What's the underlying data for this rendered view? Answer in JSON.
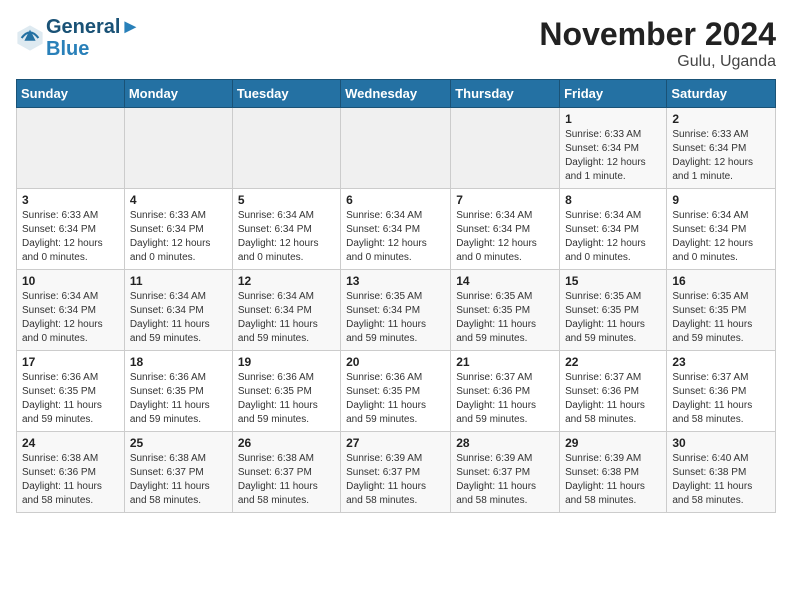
{
  "header": {
    "logo_line1": "General",
    "logo_line2": "Blue",
    "month_title": "November 2024",
    "location": "Gulu, Uganda"
  },
  "weekdays": [
    "Sunday",
    "Monday",
    "Tuesday",
    "Wednesday",
    "Thursday",
    "Friday",
    "Saturday"
  ],
  "weeks": [
    {
      "days": [
        {
          "num": "",
          "info": ""
        },
        {
          "num": "",
          "info": ""
        },
        {
          "num": "",
          "info": ""
        },
        {
          "num": "",
          "info": ""
        },
        {
          "num": "",
          "info": ""
        },
        {
          "num": "1",
          "info": "Sunrise: 6:33 AM\nSunset: 6:34 PM\nDaylight: 12 hours and 1 minute."
        },
        {
          "num": "2",
          "info": "Sunrise: 6:33 AM\nSunset: 6:34 PM\nDaylight: 12 hours and 1 minute."
        }
      ]
    },
    {
      "days": [
        {
          "num": "3",
          "info": "Sunrise: 6:33 AM\nSunset: 6:34 PM\nDaylight: 12 hours and 0 minutes."
        },
        {
          "num": "4",
          "info": "Sunrise: 6:33 AM\nSunset: 6:34 PM\nDaylight: 12 hours and 0 minutes."
        },
        {
          "num": "5",
          "info": "Sunrise: 6:34 AM\nSunset: 6:34 PM\nDaylight: 12 hours and 0 minutes."
        },
        {
          "num": "6",
          "info": "Sunrise: 6:34 AM\nSunset: 6:34 PM\nDaylight: 12 hours and 0 minutes."
        },
        {
          "num": "7",
          "info": "Sunrise: 6:34 AM\nSunset: 6:34 PM\nDaylight: 12 hours and 0 minutes."
        },
        {
          "num": "8",
          "info": "Sunrise: 6:34 AM\nSunset: 6:34 PM\nDaylight: 12 hours and 0 minutes."
        },
        {
          "num": "9",
          "info": "Sunrise: 6:34 AM\nSunset: 6:34 PM\nDaylight: 12 hours and 0 minutes."
        }
      ]
    },
    {
      "days": [
        {
          "num": "10",
          "info": "Sunrise: 6:34 AM\nSunset: 6:34 PM\nDaylight: 12 hours and 0 minutes."
        },
        {
          "num": "11",
          "info": "Sunrise: 6:34 AM\nSunset: 6:34 PM\nDaylight: 11 hours and 59 minutes."
        },
        {
          "num": "12",
          "info": "Sunrise: 6:34 AM\nSunset: 6:34 PM\nDaylight: 11 hours and 59 minutes."
        },
        {
          "num": "13",
          "info": "Sunrise: 6:35 AM\nSunset: 6:34 PM\nDaylight: 11 hours and 59 minutes."
        },
        {
          "num": "14",
          "info": "Sunrise: 6:35 AM\nSunset: 6:35 PM\nDaylight: 11 hours and 59 minutes."
        },
        {
          "num": "15",
          "info": "Sunrise: 6:35 AM\nSunset: 6:35 PM\nDaylight: 11 hours and 59 minutes."
        },
        {
          "num": "16",
          "info": "Sunrise: 6:35 AM\nSunset: 6:35 PM\nDaylight: 11 hours and 59 minutes."
        }
      ]
    },
    {
      "days": [
        {
          "num": "17",
          "info": "Sunrise: 6:36 AM\nSunset: 6:35 PM\nDaylight: 11 hours and 59 minutes."
        },
        {
          "num": "18",
          "info": "Sunrise: 6:36 AM\nSunset: 6:35 PM\nDaylight: 11 hours and 59 minutes."
        },
        {
          "num": "19",
          "info": "Sunrise: 6:36 AM\nSunset: 6:35 PM\nDaylight: 11 hours and 59 minutes."
        },
        {
          "num": "20",
          "info": "Sunrise: 6:36 AM\nSunset: 6:35 PM\nDaylight: 11 hours and 59 minutes."
        },
        {
          "num": "21",
          "info": "Sunrise: 6:37 AM\nSunset: 6:36 PM\nDaylight: 11 hours and 59 minutes."
        },
        {
          "num": "22",
          "info": "Sunrise: 6:37 AM\nSunset: 6:36 PM\nDaylight: 11 hours and 58 minutes."
        },
        {
          "num": "23",
          "info": "Sunrise: 6:37 AM\nSunset: 6:36 PM\nDaylight: 11 hours and 58 minutes."
        }
      ]
    },
    {
      "days": [
        {
          "num": "24",
          "info": "Sunrise: 6:38 AM\nSunset: 6:36 PM\nDaylight: 11 hours and 58 minutes."
        },
        {
          "num": "25",
          "info": "Sunrise: 6:38 AM\nSunset: 6:37 PM\nDaylight: 11 hours and 58 minutes."
        },
        {
          "num": "26",
          "info": "Sunrise: 6:38 AM\nSunset: 6:37 PM\nDaylight: 11 hours and 58 minutes."
        },
        {
          "num": "27",
          "info": "Sunrise: 6:39 AM\nSunset: 6:37 PM\nDaylight: 11 hours and 58 minutes."
        },
        {
          "num": "28",
          "info": "Sunrise: 6:39 AM\nSunset: 6:37 PM\nDaylight: 11 hours and 58 minutes."
        },
        {
          "num": "29",
          "info": "Sunrise: 6:39 AM\nSunset: 6:38 PM\nDaylight: 11 hours and 58 minutes."
        },
        {
          "num": "30",
          "info": "Sunrise: 6:40 AM\nSunset: 6:38 PM\nDaylight: 11 hours and 58 minutes."
        }
      ]
    }
  ]
}
